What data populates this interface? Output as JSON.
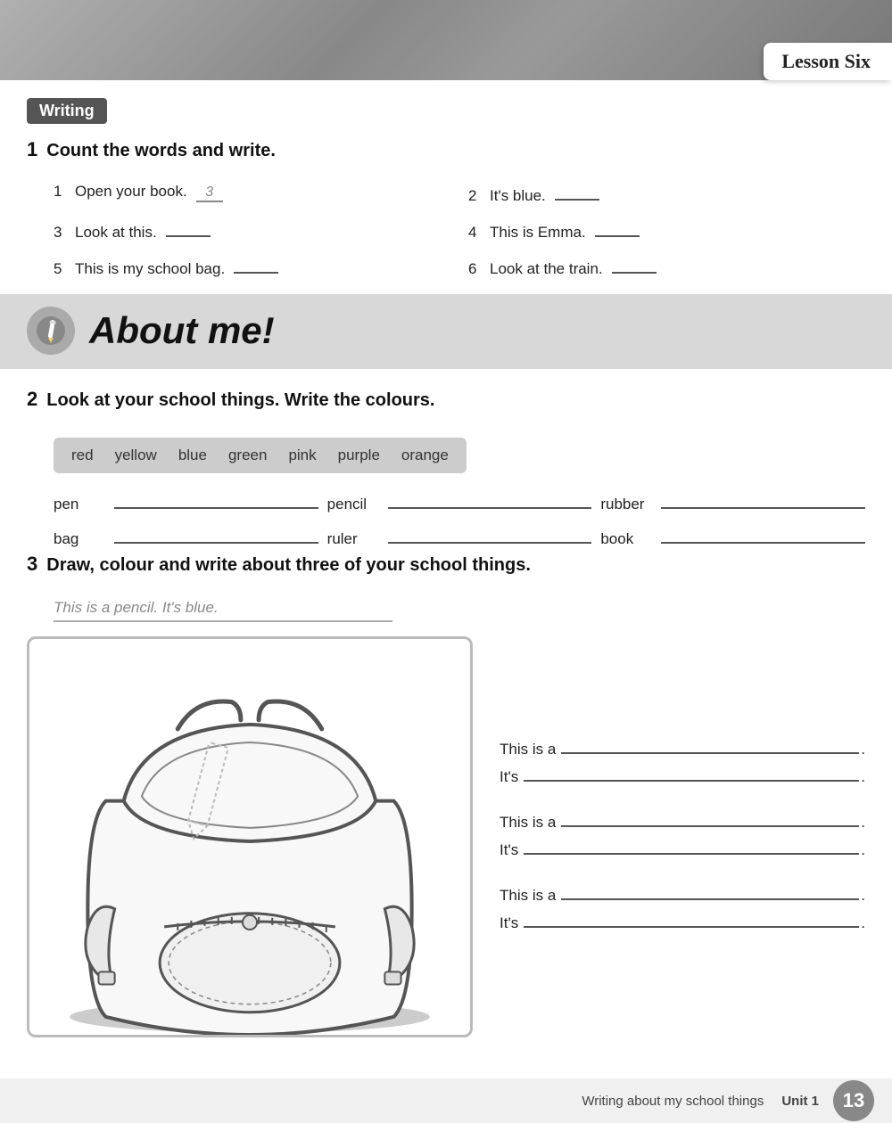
{
  "lesson": {
    "tab_label": "Lesson Six",
    "writing_label": "Writing"
  },
  "section1": {
    "number": "1",
    "title": "Count the words and write.",
    "items": [
      {
        "num": "1",
        "text": "Open your book.",
        "answer": "3",
        "filled": true
      },
      {
        "num": "2",
        "text": "It's blue.",
        "answer": "",
        "filled": false
      },
      {
        "num": "3",
        "text": "Look at this.",
        "answer": "",
        "filled": false
      },
      {
        "num": "4",
        "text": "This is Emma.",
        "answer": "",
        "filled": false
      },
      {
        "num": "5",
        "text": "This is my school bag.",
        "answer": "",
        "filled": false
      },
      {
        "num": "6",
        "text": "Look at the train.",
        "answer": "",
        "filled": false
      }
    ]
  },
  "about_me": {
    "title": "About me!"
  },
  "section2": {
    "number": "2",
    "title": "Look at your school things. Write the colours.",
    "colours": [
      "red",
      "yellow",
      "blue",
      "green",
      "pink",
      "purple",
      "orange"
    ],
    "items": [
      {
        "label": "pen"
      },
      {
        "label": "pencil"
      },
      {
        "label": "rubber"
      },
      {
        "label": "bag"
      },
      {
        "label": "ruler"
      },
      {
        "label": "book"
      }
    ]
  },
  "section3": {
    "number": "3",
    "title": "Draw, colour and write about three of your school things.",
    "example": "This is a pencil. It's blue.",
    "sentences": [
      {
        "prefix": "This is a",
        "suffix": "."
      },
      {
        "prefix": "It's",
        "suffix": "."
      },
      {
        "prefix": "This is a",
        "suffix": "."
      },
      {
        "prefix": "It's",
        "suffix": "."
      },
      {
        "prefix": "This is a",
        "suffix": "."
      },
      {
        "prefix": "It's",
        "suffix": "."
      }
    ]
  },
  "footer": {
    "label": "Writing about my school things",
    "unit_label": "Unit 1",
    "page_number": "13"
  },
  "icons": {
    "pencil": "✏️"
  }
}
